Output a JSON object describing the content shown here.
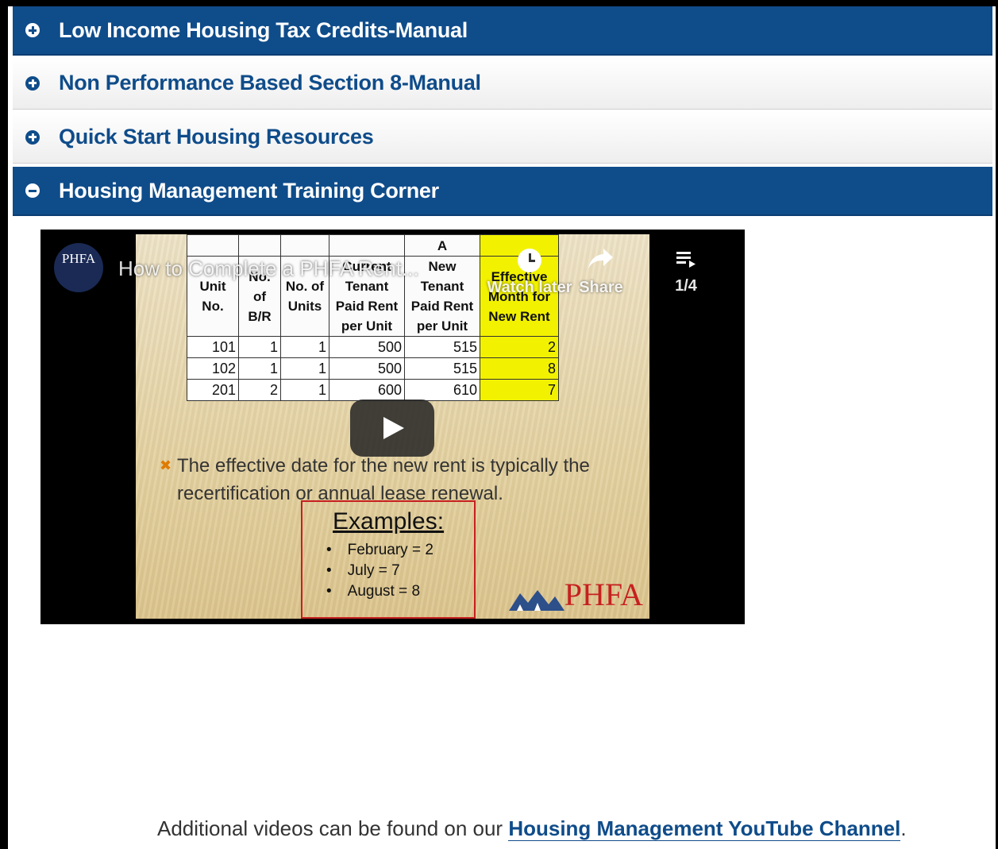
{
  "accordion": [
    {
      "label": "Low Income Housing Tax Credits-Manual",
      "state": "collapsed",
      "icon": "plus-circle-icon"
    },
    {
      "label": "Non Performance Based Section 8-Manual",
      "state": "collapsed",
      "icon": "plus-circle-icon"
    },
    {
      "label": "Quick Start Housing Resources",
      "state": "collapsed",
      "icon": "plus-circle-icon"
    },
    {
      "label": "Housing Management Training Corner",
      "state": "expanded",
      "icon": "minus-circle-icon"
    }
  ],
  "video": {
    "channel_logo_text": "PHFA",
    "title": "How to Complete a PHFA Rent...",
    "watch_later_label": "Watch later",
    "share_label": "Share",
    "playlist_position": "1/4",
    "slide": {
      "column_letter": "A",
      "headers": [
        "Unit No.",
        "No. of B/R",
        "No. of Units",
        "Current Tenant Paid Rent per Unit",
        "New Tenant Paid Rent per Unit",
        "Effective Month for New Rent"
      ],
      "rows": [
        [
          "101",
          "1",
          "1",
          "500",
          "515",
          "2"
        ],
        [
          "102",
          "1",
          "1",
          "500",
          "515",
          "8"
        ],
        [
          "201",
          "2",
          "1",
          "600",
          "610",
          "7"
        ]
      ],
      "bullet": "The effective date for the new rent is typically the recertification or annual lease renewal.",
      "examples_title": "Examples:",
      "examples": [
        "February = 2",
        "July = 7",
        "August = 8"
      ],
      "logo_text": "PHFA"
    }
  },
  "footer": {
    "text": "Additional videos can be found on our ",
    "link": "Housing Management YouTube Channel",
    "end": "."
  },
  "colors": {
    "brand_blue": "#0f4c8a",
    "highlight_yellow": "#f2f200",
    "logo_red": "#c62020"
  }
}
